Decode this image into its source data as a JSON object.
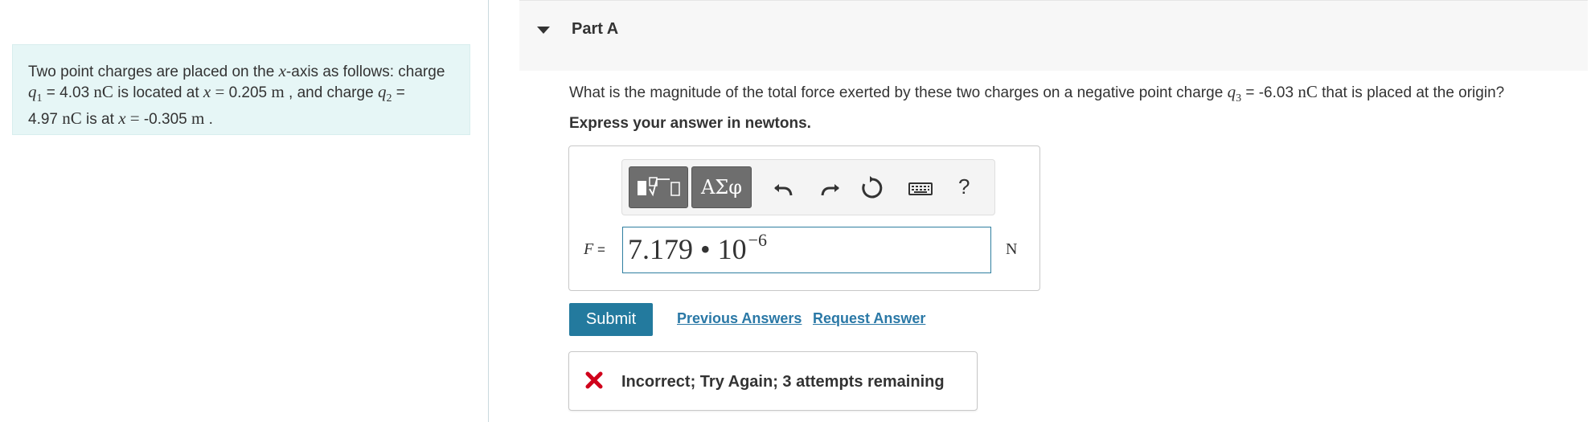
{
  "problem": {
    "t1": "Two point charges are placed on the ",
    "axis_var": "x",
    "t2": "-axis as follows: charge",
    "q1_sym": "q",
    "q1_sub": "1",
    "t3": " = 4.03 ",
    "unit_nC": "nC",
    "t4": " is located at ",
    "x_sym": "x",
    "eq": " = ",
    "x1_val": "0.205",
    "unit_m": "m",
    "t5": " , and charge ",
    "q2_sym": "q",
    "q2_sub": "2",
    "t6": " =",
    "q2_val": "4.97 ",
    "t7": " is at ",
    "x2_val": "-0.305 ",
    "t8": " ."
  },
  "part": {
    "title": "Part A"
  },
  "question": {
    "q_pre": "What is the magnitude of the total force exerted by these two charges on a negative point charge ",
    "q3_sym": "q",
    "q3_sub": "3",
    "q_mid": " = -6.03 ",
    "unit_nC": "nC",
    "q_post": " that is placed at the origin?",
    "instruction": "Express your answer in newtons."
  },
  "answer": {
    "var_label": "F",
    "eq": " =",
    "value_mantissa": "7.179 • 10",
    "value_exponent": "−6",
    "unit": "N"
  },
  "toolbar": {
    "symbols_label": "ΑΣφ",
    "help_label": "?"
  },
  "actions": {
    "submit_label": "Submit",
    "previous_answers_label": "Previous Answers",
    "request_answer_label": "Request Answer"
  },
  "feedback": {
    "text": "Incorrect; Try Again; 3 attempts remaining",
    "status_color": "#d0021b"
  },
  "colors": {
    "accent": "#237a9e",
    "link": "#2a78a6",
    "problem_bg": "#e6f6f6"
  }
}
